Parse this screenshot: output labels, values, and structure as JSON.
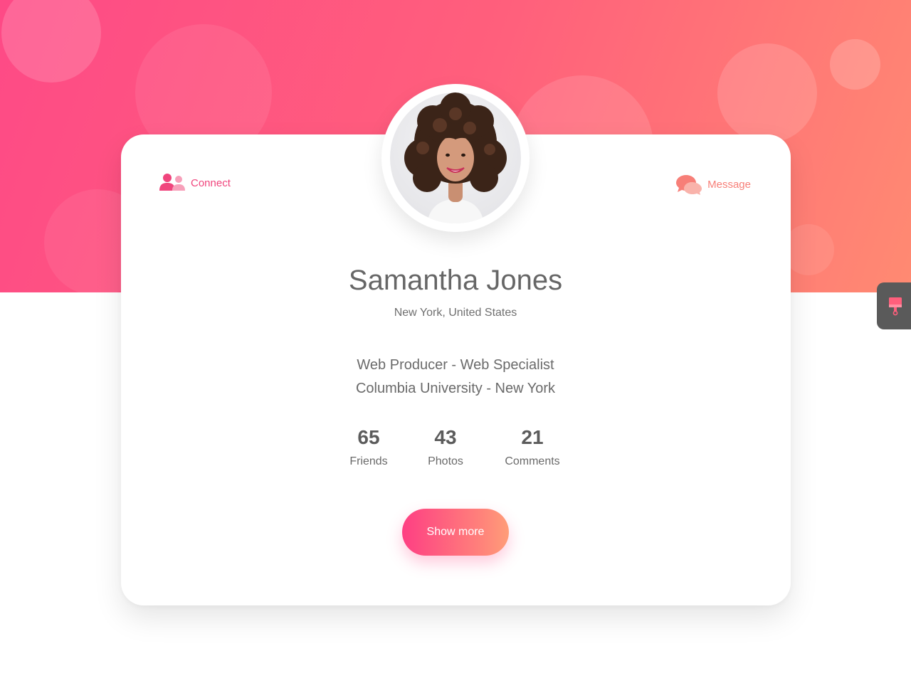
{
  "colors": {
    "accent_pink": "#fe4a86",
    "accent_coral": "#ff8a72",
    "text_gray": "#666666",
    "side_tab_bg": "#5a5a5a"
  },
  "profile": {
    "name": "Samantha Jones",
    "location": "New York, United States",
    "bio_lines": [
      "Web Producer - Web Specialist",
      "Columbia University - New York"
    ],
    "avatar_icon": "profile-photo"
  },
  "actions": {
    "connect": {
      "label": "Connect",
      "icon": "users-icon"
    },
    "message": {
      "label": "Message",
      "icon": "chat-bubbles-icon"
    }
  },
  "stats": [
    {
      "value": "65",
      "label": "Friends"
    },
    {
      "value": "43",
      "label": "Photos"
    },
    {
      "value": "21",
      "label": "Comments"
    }
  ],
  "button": {
    "label": "Show more"
  },
  "side_tab": {
    "icon": "paint-brush-icon"
  }
}
